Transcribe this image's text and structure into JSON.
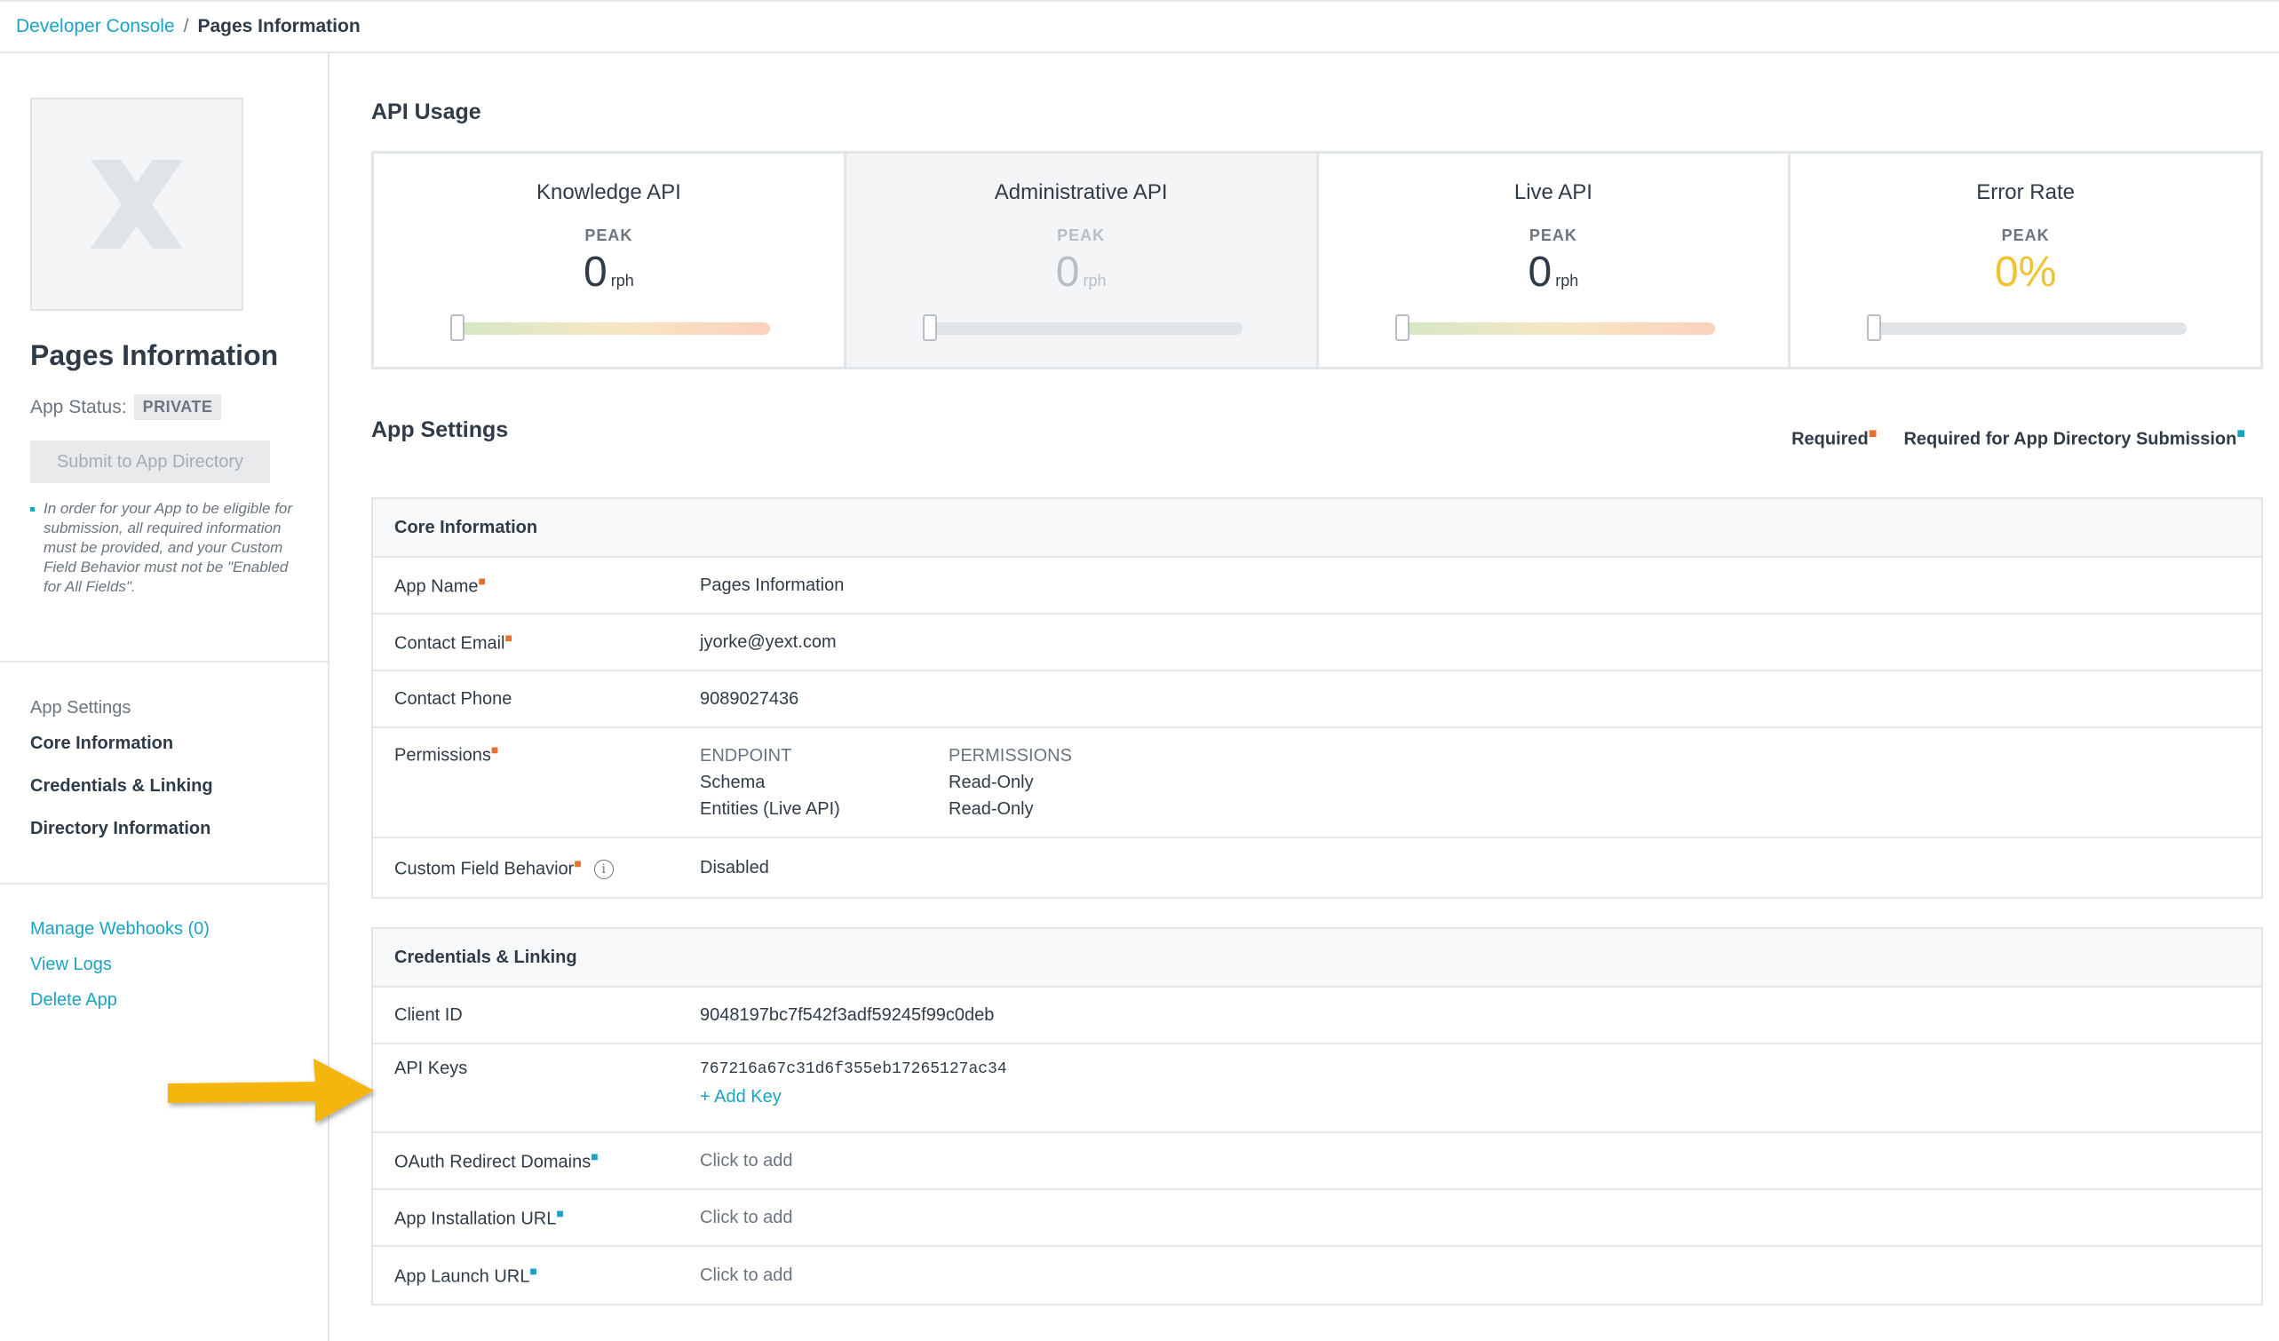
{
  "breadcrumb": {
    "root": "Developer Console",
    "separator": "/",
    "current": "Pages Information"
  },
  "sidebar": {
    "app_title": "Pages Information",
    "status_label": "App Status:",
    "status_badge": "PRIVATE",
    "submit_button": "Submit to App Directory",
    "note": "In order for your App to be eligible for submission, all required information must be provided, and your Custom Field Behavior must not be \"Enabled for All Fields\".",
    "section_label": "App Settings",
    "items": [
      "Core Information",
      "Credentials & Linking",
      "Directory Information"
    ],
    "links": [
      "Manage Webhooks (0)",
      "View Logs",
      "Delete App"
    ]
  },
  "api_usage": {
    "title": "API Usage",
    "cells": [
      {
        "name": "Knowledge API",
        "peak": "PEAK",
        "value": "0",
        "unit": "rph",
        "gauge_fraction": 0
      },
      {
        "name": "Administrative API",
        "peak": "PEAK",
        "value": "0",
        "unit": "rph",
        "gauge_fraction": 0
      },
      {
        "name": "Live API",
        "peak": "PEAK",
        "value": "0",
        "unit": "rph",
        "gauge_fraction": 0
      },
      {
        "name": "Error Rate",
        "peak": "PEAK",
        "value": "0%",
        "unit": "",
        "gauge_fraction": 0
      }
    ]
  },
  "app_settings": {
    "title": "App Settings",
    "legend_required": "Required",
    "legend_directory": "Required for App Directory Submission",
    "core": {
      "header": "Core Information",
      "app_name_label": "App Name",
      "app_name": "Pages Information",
      "contact_email_label": "Contact Email",
      "contact_email": "jyorke@yext.com",
      "contact_phone_label": "Contact Phone",
      "contact_phone": "9089027436",
      "permissions_label": "Permissions",
      "perm_endpoint_head": "ENDPOINT",
      "perm_permissions_head": "PERMISSIONS",
      "perm_endpoints": [
        "Schema",
        "Entities (Live API)"
      ],
      "perm_levels": [
        "Read-Only",
        "Read-Only"
      ],
      "custom_field_label": "Custom Field Behavior",
      "custom_field_value": "Disabled"
    },
    "credentials": {
      "header": "Credentials & Linking",
      "client_id_label": "Client ID",
      "client_id": "9048197bc7f542f3adf59245f99c0deb",
      "api_keys_label": "API Keys",
      "api_key": "767216a67c31d6f355eb17265127ac34",
      "add_key": "+ Add Key",
      "oauth_label": "OAuth Redirect Domains",
      "oauth_value": "Click to add",
      "install_label": "App Installation URL",
      "install_value": "Click to add",
      "launch_label": "App Launch URL",
      "launch_value": "Click to add"
    }
  },
  "colors": {
    "accent": "#1aa3c4",
    "required": "#e8702a",
    "error_rate": "#f1c232",
    "arrow": "#f5b50a"
  }
}
